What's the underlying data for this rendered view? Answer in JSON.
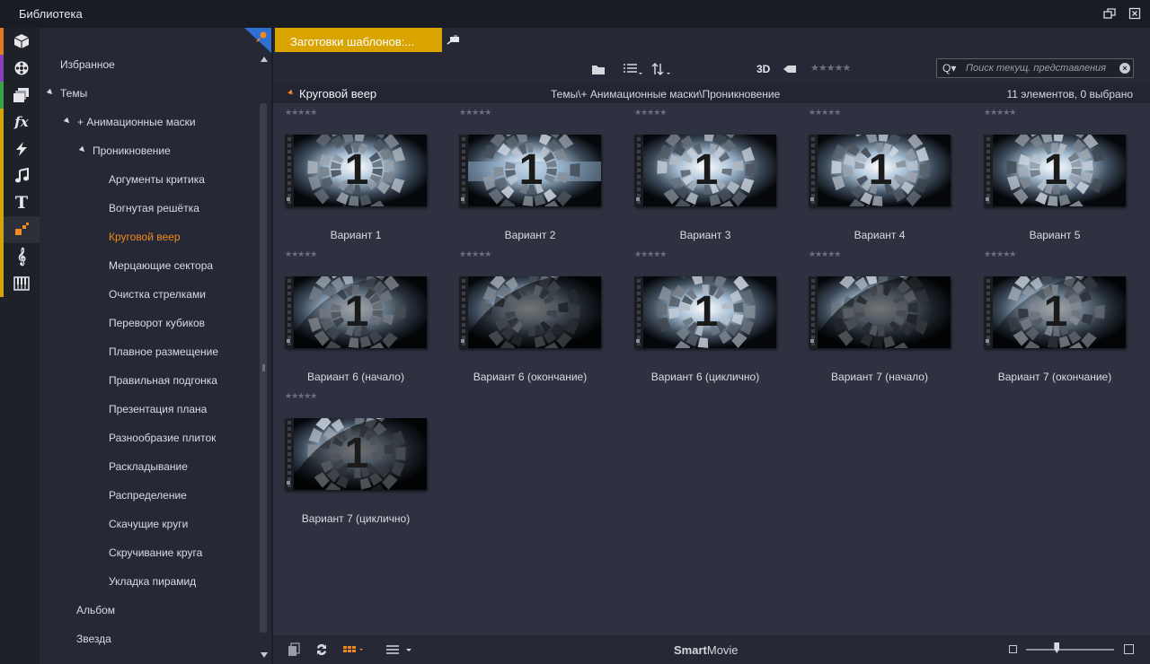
{
  "window": {
    "title": "Библиотека"
  },
  "colors": {
    "accent": "#f08a1e",
    "tab": "#d9a400"
  },
  "iconstrip": [
    {
      "icon": "box-icon",
      "bar": "#e07b28"
    },
    {
      "icon": "film-reel-icon",
      "bar": "#8a3fc0"
    },
    {
      "icon": "photo-stack-icon",
      "bar": "#3aa145"
    },
    {
      "icon": "fx-icon",
      "bar": "#d3a410"
    },
    {
      "icon": "lightning-icon",
      "bar": "#d3a410"
    },
    {
      "icon": "music-note-icon",
      "bar": "#d3a410"
    },
    {
      "icon": "title-t-icon",
      "bar": "#d3a410"
    },
    {
      "icon": "template-blocks-icon",
      "bar": "#d3a410",
      "active": true
    },
    {
      "icon": "treble-clef-icon",
      "bar": "#d3a410"
    },
    {
      "icon": "piano-icon",
      "bar": "#d3a410"
    }
  ],
  "tree": {
    "favorites": "Избранное",
    "themes": "Темы",
    "anim_masks": "+ Анимационные маски",
    "penetration": "Проникновение",
    "items": [
      "Аргументы критика",
      "Вогнутая решётка",
      "Круговой веер",
      "Мерцающие сектора",
      "Очистка стрелками",
      "Переворот кубиков",
      "Плавное размещение",
      "Правильная подгонка",
      "Презентация плана",
      "Разнообразие плиток",
      "Раскладывание",
      "Распределение",
      "Скачущие круги",
      "Скручивание круга",
      "Укладка пирамид"
    ],
    "selected_index": 2,
    "album": "Альбом",
    "star": "Звезда"
  },
  "tab": {
    "label": "Заготовки шаблонов:..."
  },
  "toolbar": {
    "threed": "3D",
    "rating": "★★★★★",
    "search_placeholder": "Поиск текущ. представления"
  },
  "crumb": {
    "title": "Круговой веер",
    "path": "Темы\\+ Анимационные маски\\Проникновение",
    "count": "11 элементов, 0 выбрано"
  },
  "grid": {
    "rating": "★★★★★",
    "items": [
      {
        "label": "Вариант 1"
      },
      {
        "label": "Вариант 2"
      },
      {
        "label": "Вариант 3"
      },
      {
        "label": "Вариант 4"
      },
      {
        "label": "Вариант 5"
      },
      {
        "label": "Вариант 6 (начало)"
      },
      {
        "label": "Вариант 6 (окончание)"
      },
      {
        "label": "Вариант 6 (циклично)"
      },
      {
        "label": "Вариант 7 (начало)"
      },
      {
        "label": "Вариант 7 (окончание)"
      },
      {
        "label": "Вариант 7 (циклично)"
      }
    ]
  },
  "status": {
    "brand_bold": "Smart",
    "brand_rest": "Movie",
    "zoom": 0.35
  }
}
